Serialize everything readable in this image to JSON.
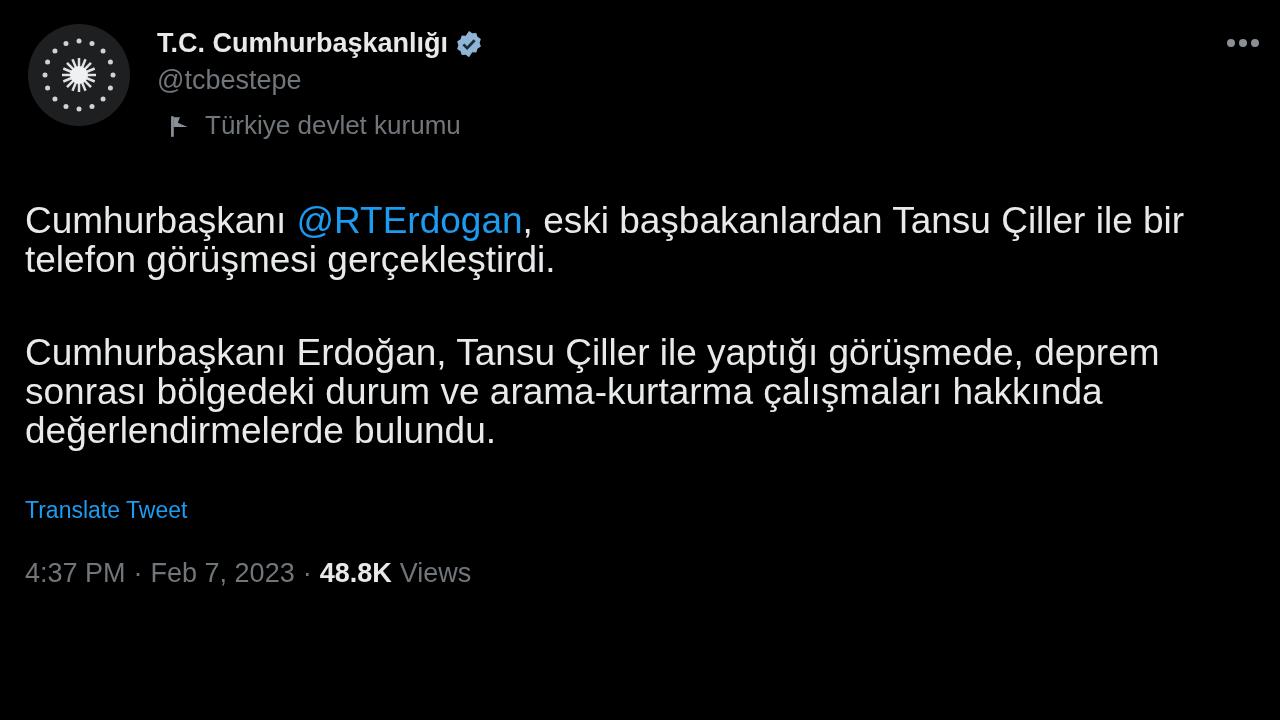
{
  "account": {
    "name": "T.C. Cumhurbaşkanlığı",
    "verified": true,
    "handle": "@tcbestepe",
    "label": "Türkiye devlet kurumu"
  },
  "paragraphs": [
    [
      {
        "kind": "text",
        "text": "Cumhurbaşkanı "
      },
      {
        "kind": "mention",
        "text": "@RTErdogan"
      },
      {
        "kind": "text",
        "text": ", eski başbakanlardan Tansu Çiller ile bir telefon görüşmesi gerçekleştirdi."
      }
    ],
    [
      {
        "kind": "text",
        "text": "Cumhurbaşkanı Erdoğan, Tansu Çiller ile yaptığı görüşmede, deprem sonrası bölgedeki durum ve arama-kurtarma çalışmaları hakkında değerlendirmelerde bulundu."
      }
    ]
  ],
  "translate_link": "Translate Tweet",
  "meta": {
    "time": "4:37 PM",
    "separator_1": "·",
    "date": "Feb 7, 2023",
    "separator_2": "·",
    "views_count": "48.8K",
    "views_label": "Views"
  }
}
